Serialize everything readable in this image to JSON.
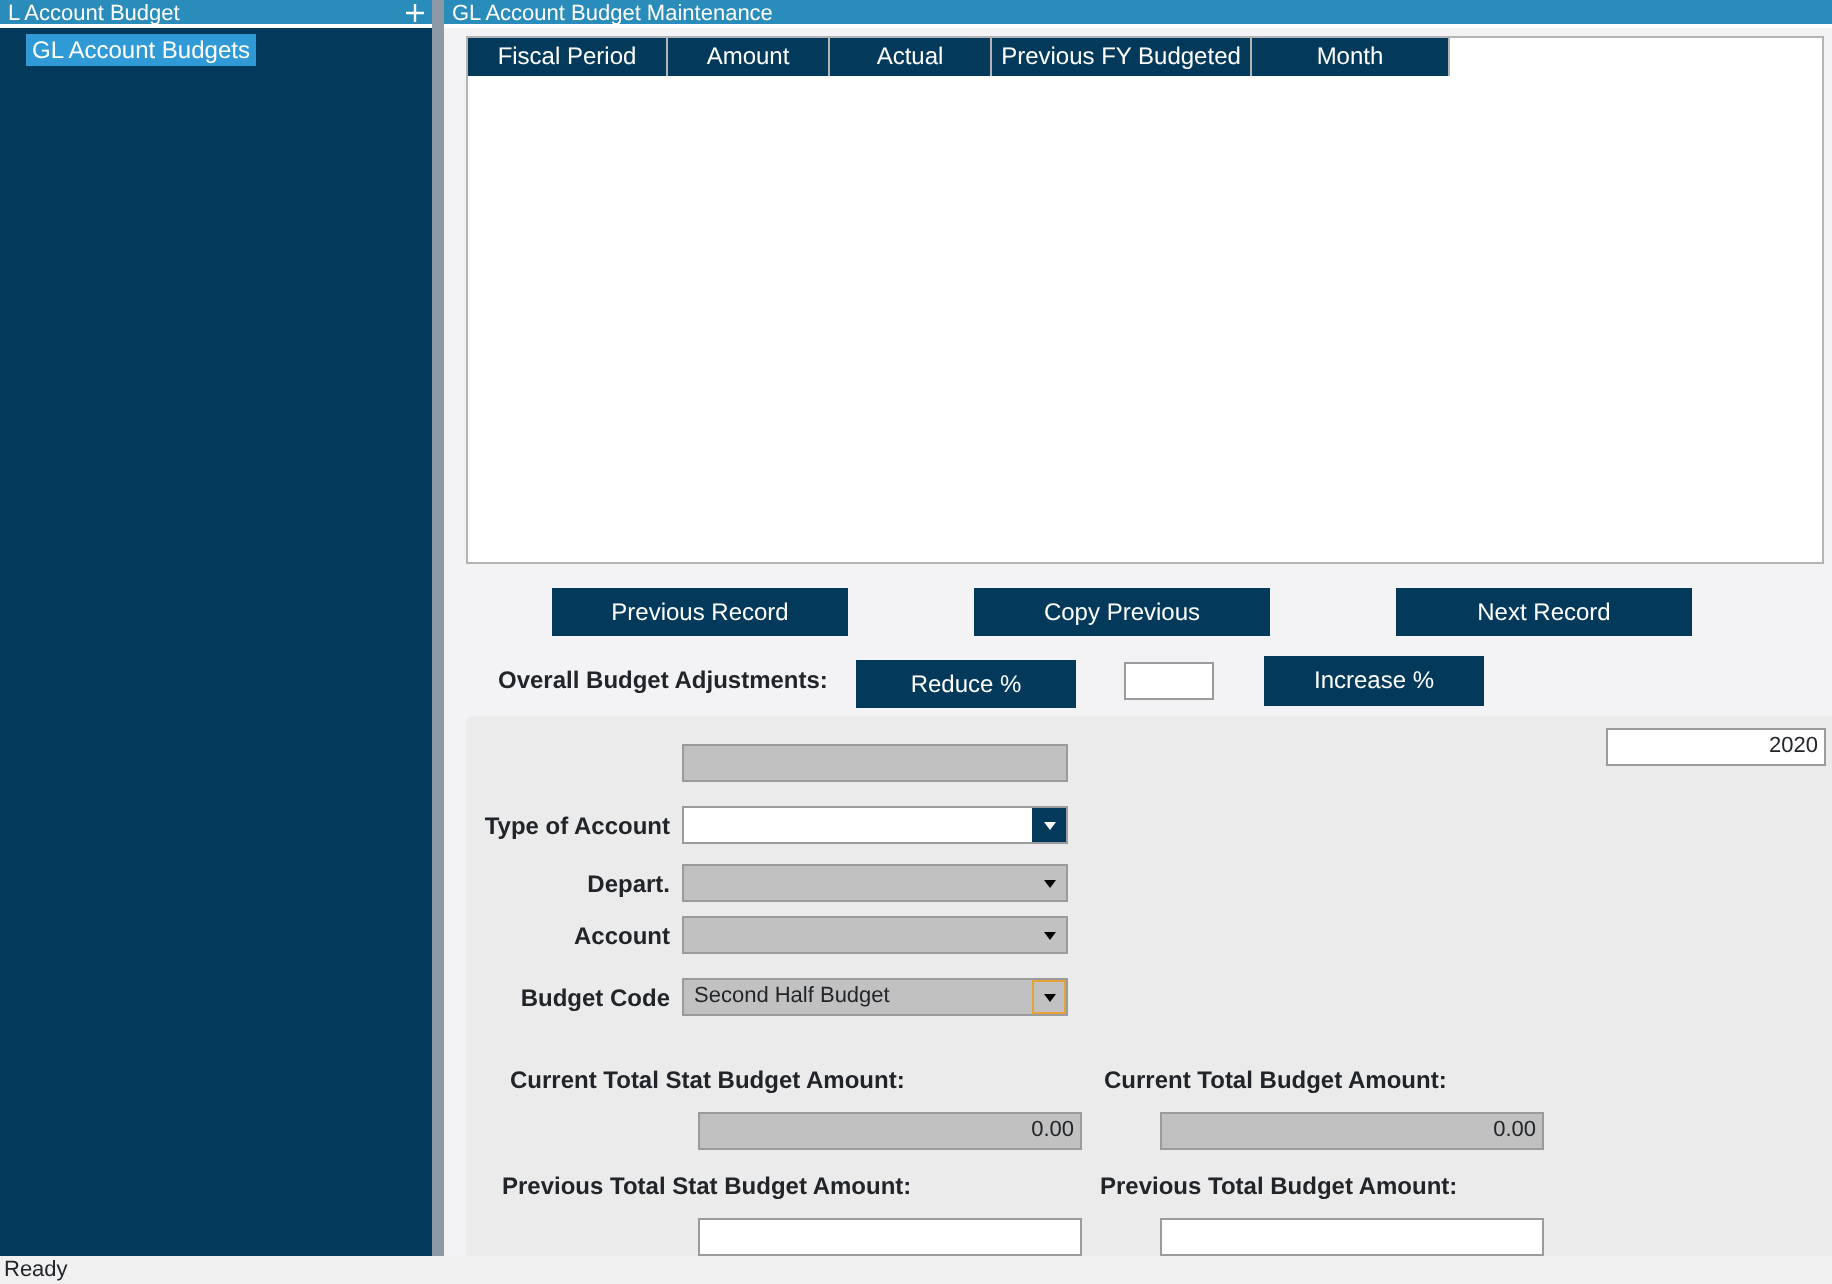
{
  "sidebar": {
    "title": "L Account Budget",
    "items": [
      {
        "label": "GL Account Budgets",
        "selected": true
      }
    ]
  },
  "main": {
    "title": "GL Account Budget Maintenance",
    "table": {
      "columns": [
        "Fiscal Period",
        "Amount",
        "Actual",
        "Previous FY Budgeted",
        "Month"
      ]
    },
    "nav_buttons": [
      "Previous Record",
      "Copy Previous",
      "Next Record"
    ],
    "adjustments": {
      "label": "Overall Budget Adjustments:",
      "reduce_button": "Reduce %",
      "increase_button": "Increase %"
    },
    "form": {
      "year": "2020",
      "fields": [
        {
          "kind": "text",
          "disabled": true
        },
        {
          "kind": "dropdown",
          "label": "Type of Account",
          "disabled": false,
          "focused": false
        },
        {
          "kind": "dropdown",
          "label": "Depart.",
          "disabled": true,
          "focused": false
        },
        {
          "kind": "dropdown",
          "label": "Account",
          "disabled": true,
          "focused": false
        },
        {
          "kind": "dropdown",
          "label": "Budget Code",
          "value": "Second Half Budget",
          "disabled": true,
          "focused": true
        }
      ]
    },
    "totals": [
      {
        "label": "Current Total Stat Budget Amount:",
        "value": "0.00"
      },
      {
        "label": "Current Total Budget Amount:",
        "value": "0.00"
      },
      {
        "label": "Previous Total Stat Budget Amount:"
      },
      {
        "label": "Previous Total Budget Amount:"
      }
    ]
  },
  "status_bar": "Ready"
}
